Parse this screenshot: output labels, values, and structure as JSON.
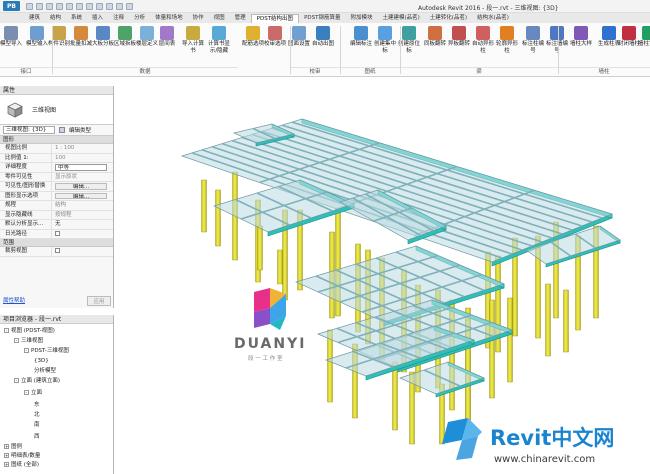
{
  "app": {
    "button": "PB",
    "title": "Autodesk Revit 2016 -    段一.rvt - 三维视图: {3D}"
  },
  "tabs": [
    "建筑",
    "结构",
    "系统",
    "插入",
    "注释",
    "分析",
    "体量和场地",
    "协作",
    "视图",
    "管理",
    "PDST结构出图",
    "PDST钢筋算量",
    "附加模块",
    "土建建模(品茗)",
    "土建转化(品茗)",
    "结构水(品茗)"
  ],
  "active_tab": "PDST结构出图",
  "ribbon": {
    "buttons": [
      "模型导入",
      "模型输入",
      "构件识别",
      "批量扣减",
      "大板分板",
      "区域拆板",
      "楼层定义",
      "层间表",
      "导入计算书",
      "计算书显示/隐藏",
      "配筋选项",
      "校审选项",
      "图面设置",
      "自动出图",
      "编辑标注",
      "创建集中标",
      "创建原位标",
      "同板翻转",
      "异板翻转",
      "自动异形柱",
      "轮廓异形柱",
      "标注柱编号",
      "标注墙编号",
      "墙柱大样",
      "生成柱表",
      "封闭墙柱",
      "墙柱设置"
    ],
    "panels": [
      "接口",
      "数据",
      "校审",
      "图纸",
      "梁",
      "墙柱"
    ]
  },
  "properties": {
    "header": "属性",
    "type_name": "三维视图",
    "selector": "三维视图: {3D}",
    "edit_type": "编辑类型",
    "group_graphics": "图形",
    "rows": [
      {
        "k": "视图比例",
        "v": "1 : 100"
      },
      {
        "k": "比例值 1:",
        "v": "100"
      },
      {
        "k": "详细程度",
        "v": "中等"
      },
      {
        "k": "零件可见性",
        "v": "显示原状"
      },
      {
        "k": "可见性/图形替换",
        "v": "编辑..."
      },
      {
        "k": "图形显示选项",
        "v": "编辑..."
      },
      {
        "k": "规程",
        "v": "结构"
      },
      {
        "k": "显示隐藏线",
        "v": "按规程"
      },
      {
        "k": "默认分析显示...",
        "v": "无"
      },
      {
        "k": "日光路径",
        "v": ""
      }
    ],
    "group_range": "范围",
    "crop_label": "裁剪视图",
    "help": "属性帮助",
    "apply": "应用"
  },
  "browser": {
    "header": "项目浏览器 - 段一.rvt",
    "items": [
      "视图 (PDST-视图)",
      "三维视图",
      "PDST-三维视图",
      "{3D}",
      "分析模型",
      "立面 (建筑立面)",
      "立面",
      "东",
      "北",
      "南",
      "西",
      "图例",
      "明细表/数量",
      "图纸 (全部)"
    ]
  },
  "watermark": {
    "brand": "DUANYI",
    "sub": "段 一 工 作 室",
    "site_name": "Revit中文网",
    "site_url": "www.chinarevit.com"
  }
}
